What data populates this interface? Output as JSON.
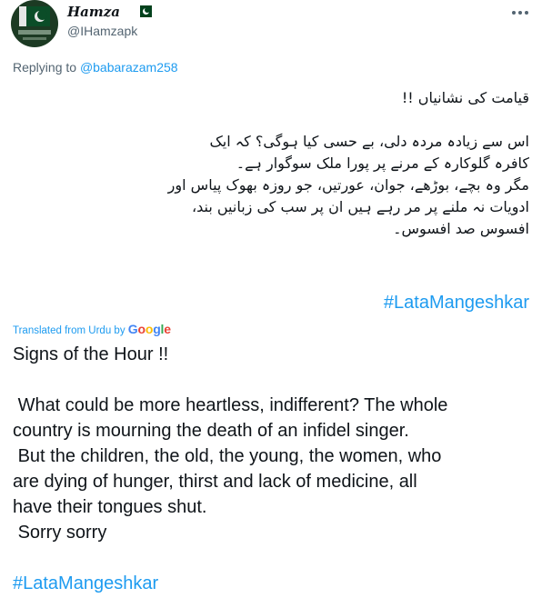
{
  "author": {
    "display_name": "Hamza",
    "handle": "@IHamzapk",
    "avatar_icon": "pakistan-flag-avatar",
    "name_badge_icon": "pakistan-flag-icon"
  },
  "more_icon": "more-horizontal-icon",
  "replying": {
    "prefix": "Replying to ",
    "mention": "@babarazam258"
  },
  "tweet_urdu": {
    "line1": "قیامت کی نشانیاں !!",
    "line2": "اس سے زیادہ مردہ دلی، بے حسی کیا ہوگی؟ کہ ایک",
    "line3": "کافرہ گلوکارہ کے مرنے پر پورا ملک سوگوار ہے۔",
    "line4": "مگر وہ بچے، بوڑھے، جوان، عورتیں، جو روزہ بھوک پیاس اور",
    "line5": "ادویات نہ ملنے پر مر رہے ہیں ان پر سب کی زبانیں بند،",
    "line6": "افسوس صد افسوس۔",
    "hashtag": "#LataMangeshkar"
  },
  "translation_label": {
    "prefix": "Translated from Urdu by ",
    "google": [
      "G",
      "o",
      "o",
      "g",
      "l",
      "e"
    ]
  },
  "translation": {
    "line1": "Signs of the Hour !!",
    "line2": " What could be more heartless, indifferent? The whole",
    "line3": "country is mourning the death of an infidel singer.",
    "line4": " But the children, the old, the young, the women, who",
    "line5": "are dying of hunger, thirst and lack of medicine, all",
    "line6": "have their tongues shut.",
    "line7": " Sorry sorry",
    "hashtag": "#LataMangeshkar"
  },
  "colors": {
    "link": "#1d9bf0",
    "secondary_text": "#536471",
    "primary_text": "#0f1419"
  }
}
